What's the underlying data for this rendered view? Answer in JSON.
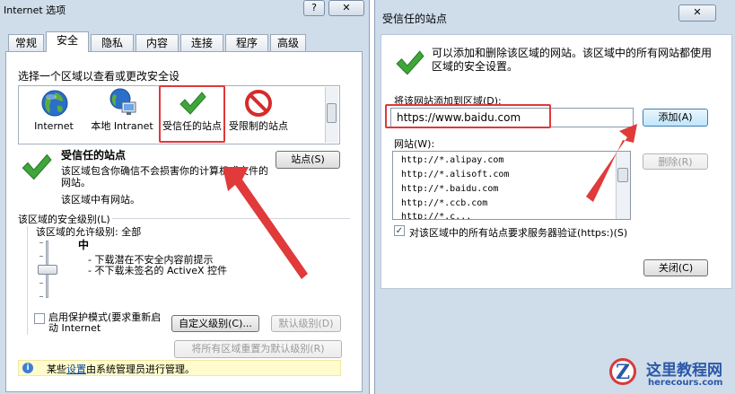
{
  "left_window": {
    "title": "Internet 选项",
    "help_button": "?",
    "close_button": "✕",
    "tabs": [
      {
        "label": "常规",
        "active": false
      },
      {
        "label": "安全",
        "active": true
      },
      {
        "label": "隐私",
        "active": false
      },
      {
        "label": "内容",
        "active": false
      },
      {
        "label": "连接",
        "active": false
      },
      {
        "label": "程序",
        "active": false
      },
      {
        "label": "高级",
        "active": false
      }
    ],
    "zone_prompt": "选择一个区域以查看或更改安全设",
    "zones": [
      {
        "label": "Internet",
        "icon": "globe-icon"
      },
      {
        "label": "本地 Intranet",
        "icon": "local-intranet-icon"
      },
      {
        "label": "受信任的站点",
        "icon": "check-icon",
        "selected": true
      },
      {
        "label": "受限制的站点",
        "icon": "no-entry-icon"
      }
    ],
    "zone_title": "受信任的站点",
    "zone_desc": "该区域包含你确信不会损害你的计算机或文件的网站。",
    "zone_nosite": "该区域中有网站。",
    "sites_button": "站点(S)",
    "level_group_label": "该区域的安全级别(L)",
    "allowed_level": "该区域的允许级别: 全部",
    "level_name": "中",
    "level_bullets": [
      "- 下载潜在不安全内容前提示",
      "- 不下载未签名的 ActiveX 控件"
    ],
    "protected_mode_label": "启用保护模式(要求重新启动 Internet",
    "custom_level_button": "自定义级别(C)...",
    "default_level_button": "默认级别(D)",
    "reset_all_button": "将所有区域重置为默认级别(R)",
    "info_prefix": "某些",
    "info_link": "设置",
    "info_suffix": "由系统管理员进行管理。"
  },
  "right_window": {
    "title": "受信任的站点",
    "close_button": "✕",
    "description": "可以添加和删除该区域的网站。该区域中的所有网站都使用区域的安全设置。",
    "add_label": "将该网站添加到区域(D):",
    "url_value": "https://www.baidu.com",
    "add_button": "添加(A)",
    "sites_label": "网站(W):",
    "sites": [
      "http://*.alipay.com",
      "http://*.alisoft.com",
      "http://*.baidu.com",
      "http://*.ccb.com",
      "http://*.c..."
    ],
    "remove_button": "删除(R)",
    "https_check_label": "对该区域中的所有站点要求服务器验证(https:)(S)",
    "https_checked": true,
    "close_dialog_button": "关闭(C)"
  },
  "watermark": {
    "logo_letter": "Z",
    "text": "这里教程网",
    "url": "herecours.com"
  },
  "colors": {
    "window_bg": "#cfdcea",
    "highlight_red": "#e0383a",
    "arrow_red": "#e03a3a",
    "link_blue": "#0645ad",
    "info_bg": "#fffbcc"
  }
}
